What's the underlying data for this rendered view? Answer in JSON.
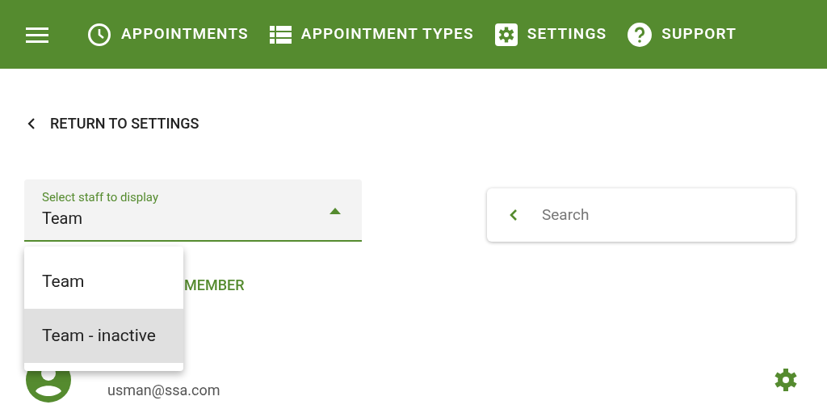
{
  "nav": [
    {
      "label": "APPOINTMENTS",
      "kind": "clock"
    },
    {
      "label": "APPOINTMENT TYPES",
      "kind": "list"
    },
    {
      "label": "SETTINGS",
      "kind": "gear"
    },
    {
      "label": "SUPPORT",
      "kind": "help"
    }
  ],
  "back_link": "RETURN TO SETTINGS",
  "staff_select": {
    "label": "Select staff to display",
    "value": "Team",
    "expanded": true,
    "options": [
      {
        "label": "Team",
        "hovered": false
      },
      {
        "label": "Team - inactive",
        "hovered": true
      }
    ]
  },
  "search": {
    "placeholder": "Search"
  },
  "add_link": "MEMBER",
  "staff": [
    {
      "email": "usman@ssa.com"
    }
  ]
}
